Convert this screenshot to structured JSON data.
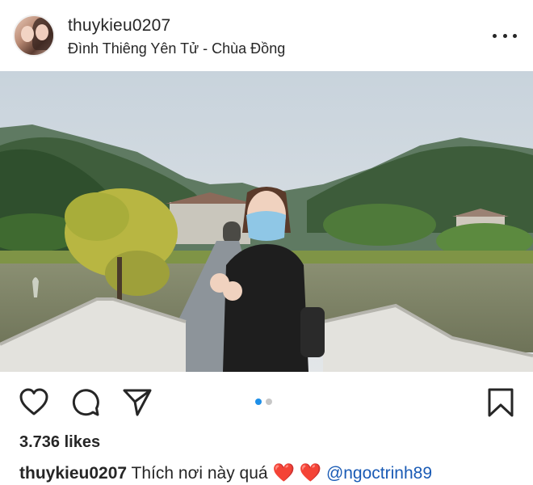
{
  "post": {
    "username": "thuykieu0207",
    "location": "Đình Thiêng Yên Tử - Chùa Đồng",
    "likes": "3.736 likes",
    "caption": {
      "username": "thuykieu0207",
      "text": "Thích nơi này quá",
      "emoji_1": "❤️",
      "emoji_2": "❤️",
      "mention": "@ngoctrinh89"
    },
    "carousel": {
      "count": 2,
      "active_index": 0
    }
  },
  "icons": {
    "more": "more-options-icon",
    "like": "heart-icon",
    "comment": "comment-icon",
    "share": "paper-plane-icon",
    "save": "bookmark-icon"
  },
  "colors": {
    "text": "#262626",
    "accent_dot": "#1e8fe8",
    "inactive_dot": "#c7c7c7",
    "mention": "#1a5bb5",
    "heart": "#e0261d"
  }
}
